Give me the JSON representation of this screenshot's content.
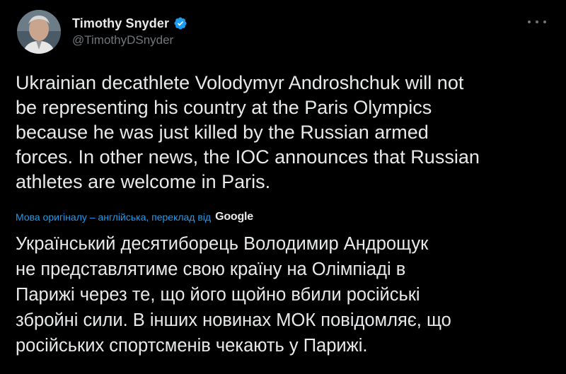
{
  "author": {
    "display_name": "Timothy Snyder",
    "handle": "@TimothyDSnyder",
    "verified": true
  },
  "tweet": {
    "text": "Ukrainian decathlete Volodymyr Androshchuk will not\nbe representing his country at the Paris Olympics\nbecause he was just killed by the Russian armed\nforces. In other news, the IOC announces that Russian\nathletes are welcome in Paris.",
    "translation_note": "Мова оригіналу – англійська, переклад від",
    "translation_provider": "Google",
    "translated_text": "Український десятиборець Володимир Андрощук\nне представлятиме свою країну на Олімпіаді в\nПарижі через те, що його щойно вбили російські\nзбройні сили. В інших новинах МОК повідомляє, що\nросійських спортсменів чекають у Парижі."
  },
  "icons": {
    "verified": "verified-badge-icon",
    "more": "more-options-icon"
  },
  "colors": {
    "background": "#000000",
    "text": "#e7e9ea",
    "secondary_text": "#71767b",
    "accent": "#1d9bf0"
  }
}
